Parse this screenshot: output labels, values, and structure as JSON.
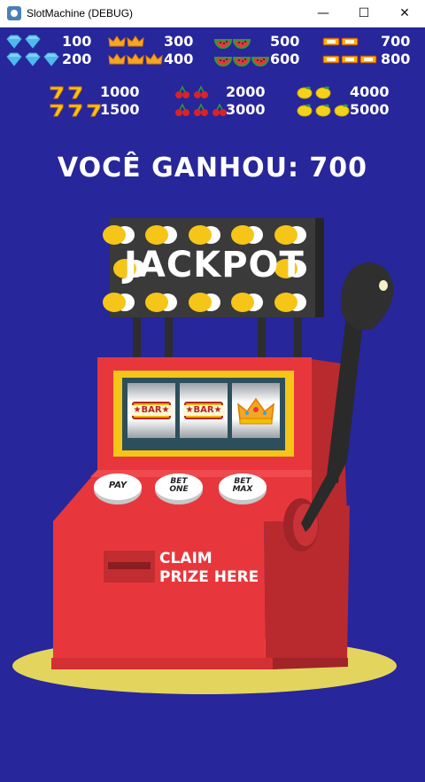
{
  "window": {
    "title": "SlotMachine (DEBUG)",
    "minimize_glyph": "—",
    "maximize_glyph": "☐",
    "close_glyph": "✕"
  },
  "paytable": [
    {
      "symbol": "diamond",
      "count": 2,
      "value": "100"
    },
    {
      "symbol": "diamond",
      "count": 3,
      "value": "200"
    },
    {
      "symbol": "crown",
      "count": 2,
      "value": "300"
    },
    {
      "symbol": "crown",
      "count": 3,
      "value": "400"
    },
    {
      "symbol": "watermelon",
      "count": 2,
      "value": "500"
    },
    {
      "symbol": "watermelon",
      "count": 3,
      "value": "600"
    },
    {
      "symbol": "bar",
      "count": 2,
      "value": "700"
    },
    {
      "symbol": "bar",
      "count": 3,
      "value": "800"
    },
    {
      "symbol": "seven",
      "count": 2,
      "value": "1000"
    },
    {
      "symbol": "seven",
      "count": 3,
      "value": "1500"
    },
    {
      "symbol": "cherry",
      "count": 2,
      "value": "2000"
    },
    {
      "symbol": "cherry",
      "count": 3,
      "value": "3000"
    },
    {
      "symbol": "lemon",
      "count": 2,
      "value": "4000"
    },
    {
      "symbol": "lemon",
      "count": 3,
      "value": "5000"
    }
  ],
  "win_message": "VOCÊ GANHOU: 700",
  "jackpot_sign": "JACKPOT",
  "reels": [
    {
      "symbol": "bar",
      "label": "★BAR★"
    },
    {
      "symbol": "bar",
      "label": "★BAR★"
    },
    {
      "symbol": "crown",
      "label": ""
    }
  ],
  "buttons": {
    "pay": "PAY",
    "bet_one_line1": "BET",
    "bet_one_line2": "ONE",
    "bet_max_line1": "BET",
    "bet_max_line2": "MAX"
  },
  "claim": {
    "line1": "CLAIM",
    "line2": "PRIZE HERE"
  },
  "colors": {
    "background": "#27269a",
    "machine_red": "#e8373c",
    "machine_dark_red": "#b92a2e",
    "sign_dark": "#2d2d2d",
    "bulb_yellow": "#f5c518",
    "floor_yellow": "#e3d45e"
  }
}
